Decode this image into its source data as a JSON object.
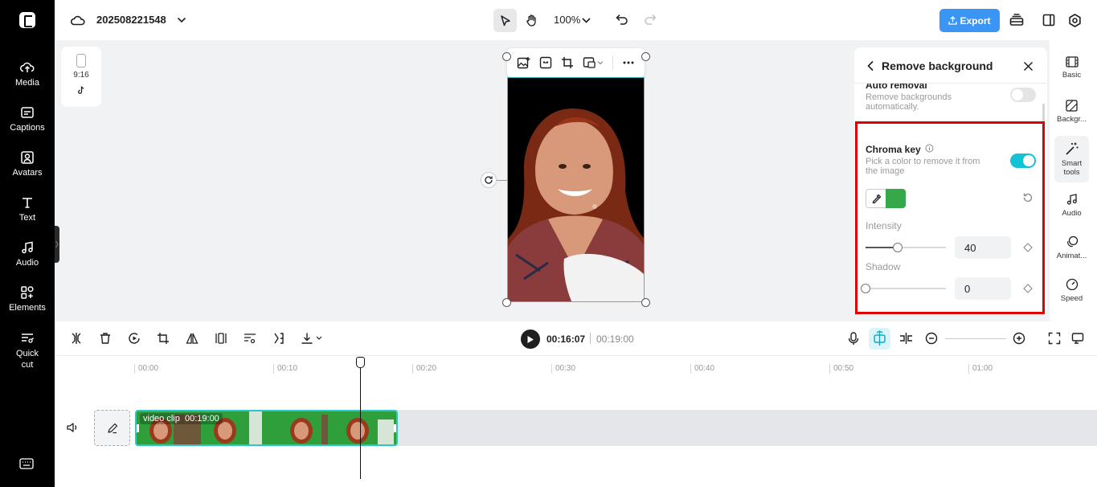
{
  "sidebar": {
    "items": [
      {
        "label": "Media",
        "icon": "media-cloud-icon"
      },
      {
        "label": "Captions",
        "icon": "captions-icon"
      },
      {
        "label": "Avatars",
        "icon": "avatars-icon"
      },
      {
        "label": "Text",
        "icon": "text-icon"
      },
      {
        "label": "Audio",
        "icon": "music-note-icon"
      },
      {
        "label": "Elements",
        "icon": "elements-icon"
      },
      {
        "label": "Quick cut",
        "icon": "quick-cut-icon"
      }
    ]
  },
  "header": {
    "project_name": "202508221548",
    "zoom": "100%",
    "export_label": "Export"
  },
  "canvas": {
    "aspect_ratio": "9:16"
  },
  "panel": {
    "title": "Remove background",
    "auto_removal": {
      "title": "Auto removal",
      "description": "Remove backgrounds automatically.",
      "enabled": false
    },
    "chroma_key": {
      "title": "Chroma key",
      "description": "Pick a color to remove it from the image",
      "enabled": true,
      "color": "#35a84a"
    },
    "intensity": {
      "label": "Intensity",
      "value": "40",
      "fraction": 0.4
    },
    "shadow": {
      "label": "Shadow",
      "value": "0",
      "fraction": 0
    }
  },
  "tool_strip": {
    "items": [
      {
        "label": "Basic"
      },
      {
        "label": "Backgr..."
      },
      {
        "label": "Smart tools"
      },
      {
        "label": "Audio"
      },
      {
        "label": "Animat..."
      },
      {
        "label": "Speed"
      }
    ]
  },
  "timeline": {
    "current_time": "00:16:07",
    "duration": "00:19:00",
    "ruler": [
      "00:00",
      "00:10",
      "00:20",
      "00:30",
      "00:40",
      "00:50",
      "01:00"
    ],
    "clip": {
      "label": "video clip",
      "length": "00:19:00"
    }
  },
  "colors": {
    "accent": "#2fc2cf",
    "export": "#3b95f5",
    "highlight_box": "#e00000",
    "toggle_on": "#12c3d6"
  }
}
